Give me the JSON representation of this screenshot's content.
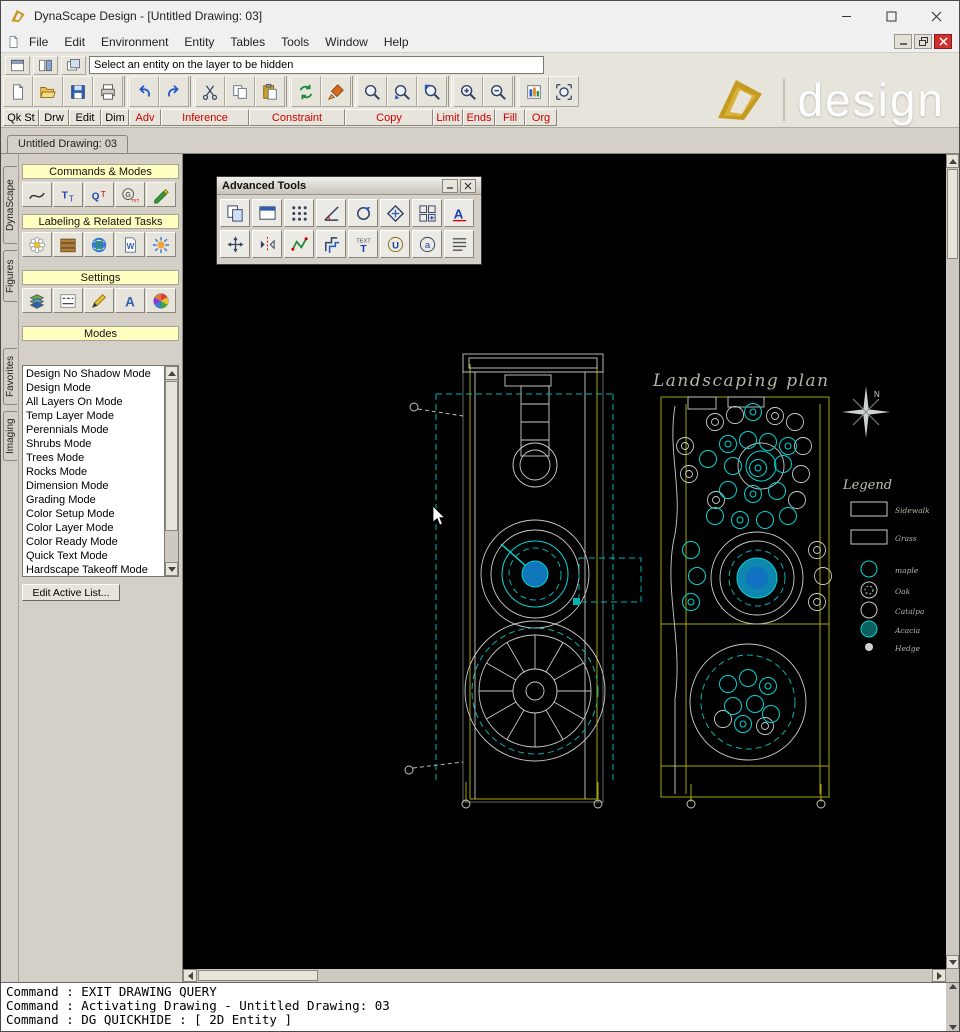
{
  "window": {
    "title": "DynaScape Design  - [Untitled Drawing: 03]"
  },
  "menu": {
    "items": [
      "File",
      "Edit",
      "Environment",
      "Entity",
      "Tables",
      "Tools",
      "Window",
      "Help"
    ]
  },
  "toolbar": {
    "prompt_value": "Select an entity on the layer to be hidden",
    "arrange_buttons": [
      {
        "name": "new-window-icon"
      },
      {
        "name": "tile-windows-icon"
      },
      {
        "name": "cascade-windows-icon"
      }
    ],
    "buttons": [
      {
        "name": "new-drawing",
        "icon": "new"
      },
      {
        "name": "open-drawing",
        "icon": "open"
      },
      {
        "name": "save-drawing",
        "icon": "save"
      },
      {
        "name": "print-drawing",
        "icon": "print"
      },
      {
        "name": "undo",
        "icon": "undo",
        "sep": true
      },
      {
        "name": "redo",
        "icon": "redo"
      },
      {
        "name": "cut",
        "icon": "cut",
        "sep": true
      },
      {
        "name": "copy",
        "icon": "copy"
      },
      {
        "name": "paste",
        "icon": "paste"
      },
      {
        "name": "update-display",
        "icon": "refresh",
        "sep": true
      },
      {
        "name": "format-painter",
        "icon": "brush"
      },
      {
        "name": "zoom-window",
        "icon": "zoom",
        "sep": true
      },
      {
        "name": "zoom-dynamic",
        "icon": "zoomwin"
      },
      {
        "name": "zoom-previous",
        "icon": "zoomprev"
      },
      {
        "name": "zoom-in",
        "icon": "zoomin",
        "sep": true
      },
      {
        "name": "zoom-out",
        "icon": "zoomout"
      },
      {
        "name": "fill-display",
        "icon": "fillchart",
        "sep": true
      },
      {
        "name": "zoom-extents",
        "icon": "zoomorg"
      }
    ],
    "labels": [
      {
        "text": "Qk St",
        "color": "#000000"
      },
      {
        "text": "Drw",
        "color": "#000000"
      },
      {
        "text": "Edit",
        "color": "#000000"
      },
      {
        "text": "Dim",
        "color": "#000000"
      },
      {
        "text": "Adv",
        "color": "#cc0000"
      },
      {
        "text": "Inference",
        "color": "#cc0000"
      },
      {
        "text": "Constraint",
        "color": "#cc0000"
      },
      {
        "text": "Copy",
        "color": "#cc0000"
      },
      {
        "text": "Limit",
        "color": "#cc0000"
      },
      {
        "text": "Ends",
        "color": "#cc0000"
      },
      {
        "text": "Fill",
        "color": "#cc0000"
      },
      {
        "text": "Org",
        "color": "#cc0000"
      }
    ],
    "logo_text": "design"
  },
  "drawing_tab": "Untitled Drawing: 03",
  "sidebar": {
    "vertical_tabs": [
      "DynaScape",
      "Figures",
      "Favorites",
      "Imaging"
    ],
    "panels": {
      "commands": {
        "title": "Commands & Modes",
        "icons": [
          "sketch-tool-icon",
          "title-text-icon",
          "quick-text-icon",
          "general-text-icon",
          "label-tool-icon"
        ]
      },
      "labeling": {
        "title": "Labeling & Related Tasks",
        "icons": [
          "plant-label-icon",
          "material-takeoff-icon",
          "web-tools-icon",
          "word-export-icon",
          "season-color-icon"
        ]
      },
      "settings": {
        "title": "Settings",
        "icons": [
          "layer-settings-icon",
          "line-style-icon",
          "pen-settings-icon",
          "font-settings-icon",
          "color-settings-icon"
        ]
      },
      "modes": {
        "title": "Modes"
      }
    },
    "modes_list": [
      "Design No Shadow Mode",
      "Design Mode",
      "All Layers On Mode",
      "Temp Layer Mode",
      "Perennials Mode",
      "Shrubs Mode",
      "Trees Mode",
      "Rocks Mode",
      "Dimension Mode",
      "Grading Mode",
      "Color Setup Mode",
      "Color Layer Mode",
      "Color Ready Mode",
      "Quick Text Mode",
      "Hardscape Takeoff Mode"
    ],
    "edit_button": "Edit Active List..."
  },
  "advanced_tools": {
    "title": "Advanced Tools",
    "buttons_row1": [
      {
        "name": "copy-entities-icon",
        "icon": "a_copy"
      },
      {
        "name": "paste-window-icon",
        "icon": "a_win"
      },
      {
        "name": "array-grid-icon",
        "icon": "a_grid"
      },
      {
        "name": "measure-angle-icon",
        "icon": "a_angle"
      },
      {
        "name": "rotate-entity-icon",
        "icon": "a_rotate"
      },
      {
        "name": "scale-entity-icon",
        "icon": "a_diamond"
      },
      {
        "name": "cell-pattern-icon",
        "icon": "a_cells"
      },
      {
        "name": "text-style-icon",
        "icon": "a_textA"
      }
    ],
    "buttons_row2": [
      {
        "name": "move-array-icon",
        "icon": "a_array"
      },
      {
        "name": "mirror-entity-icon",
        "icon": "a_flip"
      },
      {
        "name": "polyline-edit-icon",
        "icon": "a_poly"
      },
      {
        "name": "offset-entity-icon",
        "icon": "a_offset"
      },
      {
        "name": "text-label-icon",
        "icon": "a_text"
      },
      {
        "name": "group-tool-icon",
        "icon": "a_U"
      },
      {
        "name": "annotate-icon",
        "icon": "a_a"
      },
      {
        "name": "line-spacing-icon",
        "icon": "a_lines"
      }
    ]
  },
  "canvas": {
    "plan_title": "Landscaping plan",
    "compass_label": "N",
    "legend": {
      "title": "Legend",
      "items": [
        {
          "symbol": "sidewalk-swatch",
          "label": "Sidewalk"
        },
        {
          "symbol": "grass-swatch",
          "label": "Grass"
        },
        {
          "symbol": "maple-symbol",
          "label": "maple"
        },
        {
          "symbol": "oak-symbol",
          "label": "Oak"
        },
        {
          "symbol": "catalpa-symbol",
          "label": "Catalpa"
        },
        {
          "symbol": "acacia-symbol",
          "label": "Acacia"
        },
        {
          "symbol": "hedge-symbol",
          "label": "Hedge"
        }
      ]
    }
  },
  "command_area": {
    "lines": [
      "Command : EXIT DRAWING QUERY",
      "Command : Activating Drawing - Untitled Drawing: 03",
      "Command : DG QUICKHIDE : [ 2D Entity ]"
    ]
  },
  "colors": {
    "canvas_bg": "#000000",
    "line_cyan": "#00d4d4",
    "line_white": "#c8cccc",
    "line_yellow": "#a8a800",
    "fill_blue": "#1177bb",
    "label_red": "#cc0000",
    "panel_header_bg": "#ffffc2",
    "logo_gold": "#c49a20"
  }
}
